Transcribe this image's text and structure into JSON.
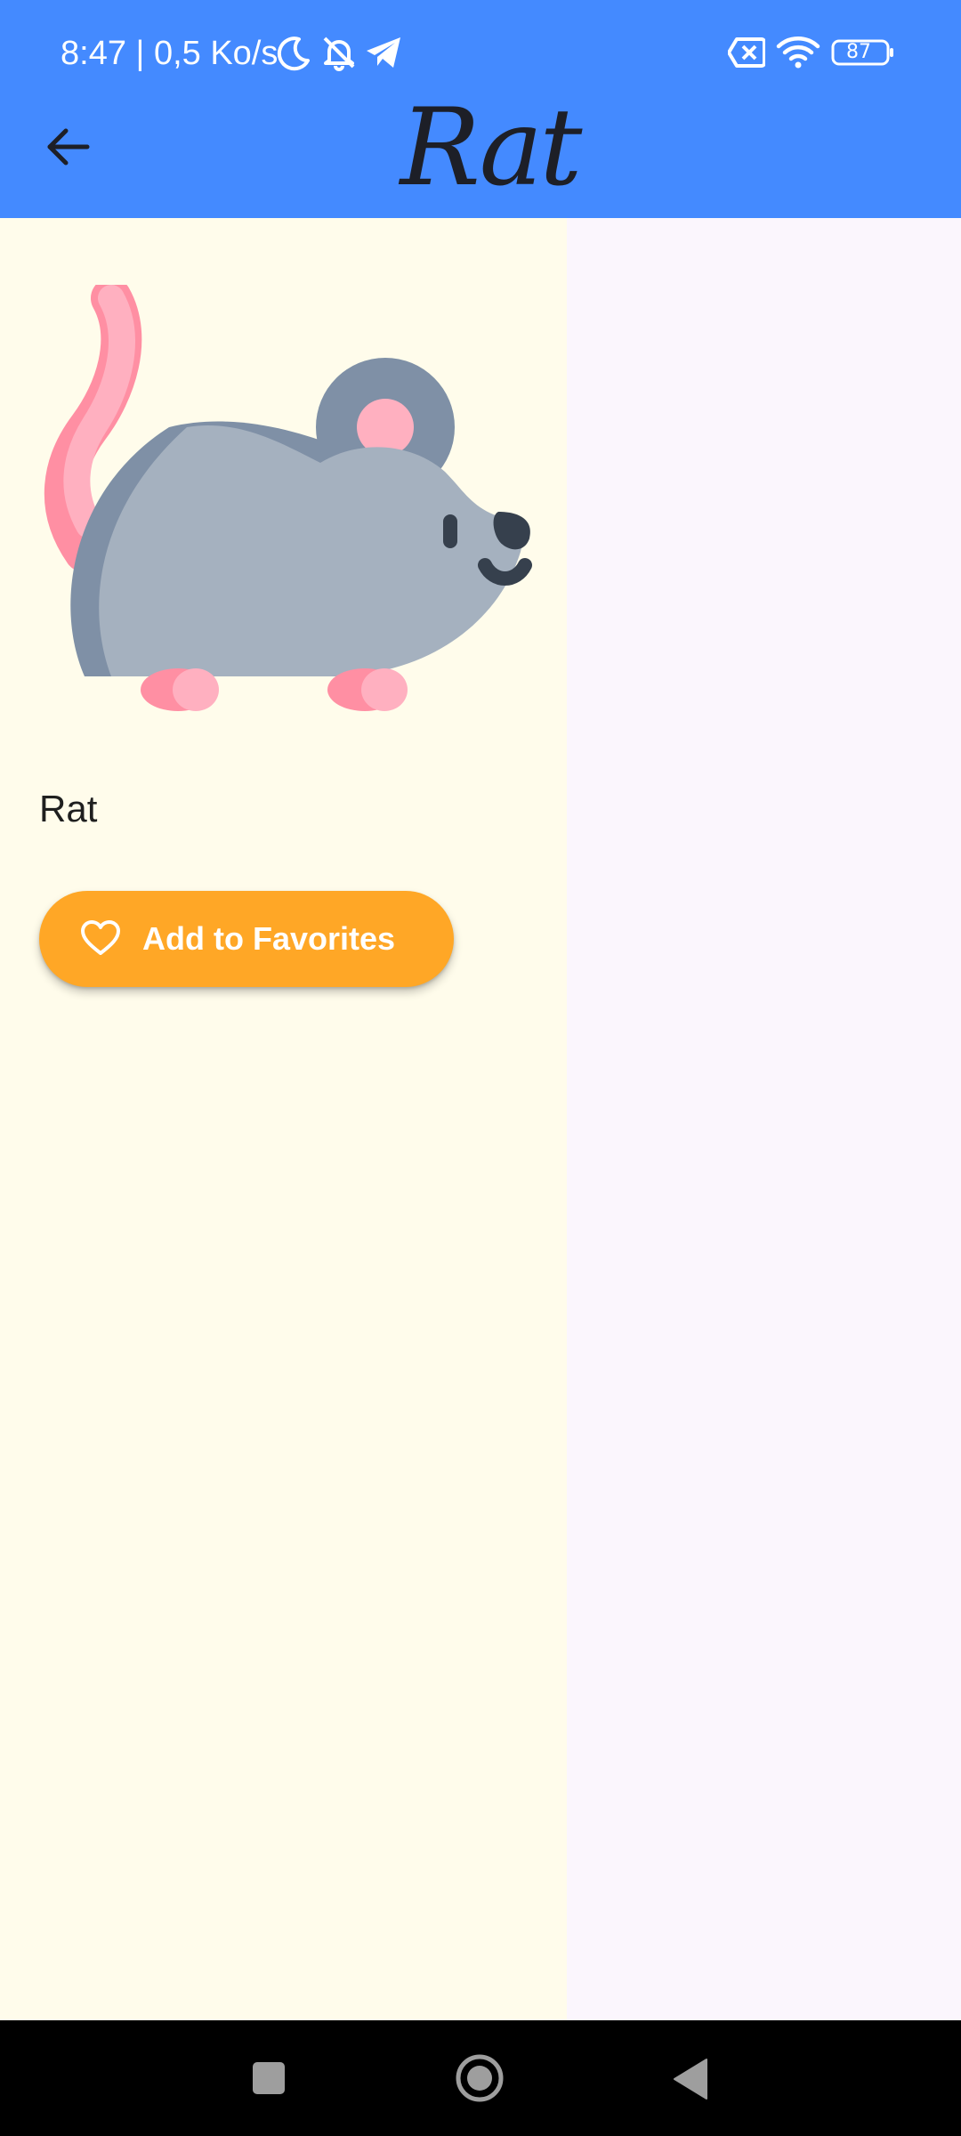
{
  "status_bar": {
    "time_and_speed": "8:47 | 0,5 Ko/s",
    "icons": [
      "moon-icon",
      "bell-off-icon",
      "telegram-icon",
      "sim-x-icon",
      "wifi-icon",
      "battery-icon"
    ],
    "battery_level": "87"
  },
  "app_bar": {
    "title": "Rat",
    "back_icon": "arrow-left-icon",
    "color": "#448AFF"
  },
  "detail": {
    "animal_name": "Rat",
    "image": "rat-illustration",
    "favorite_button": {
      "label": "Add to Favorites",
      "icon": "heart-outline-icon",
      "color": "#FFA726"
    },
    "panel_color": "#FFFCEB"
  },
  "nav_bar": {
    "buttons": [
      "recents-square-icon",
      "home-circle-icon",
      "back-triangle-icon"
    ]
  }
}
